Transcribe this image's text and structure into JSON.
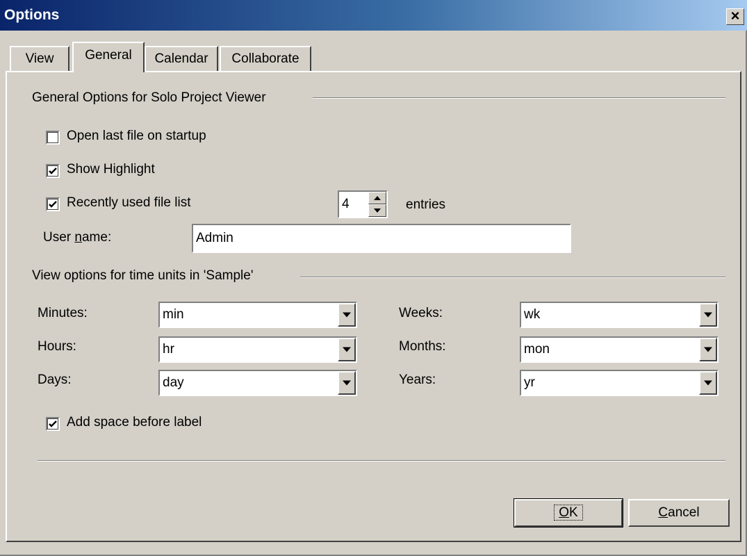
{
  "window": {
    "title": "Options",
    "close_glyph": "×"
  },
  "tabs": [
    {
      "label": "View",
      "active": false
    },
    {
      "label": "General",
      "active": true
    },
    {
      "label": "Calendar",
      "active": false
    },
    {
      "label": "Collaborate",
      "active": false
    }
  ],
  "general": {
    "section_title": "General Options for Solo Project Viewer",
    "open_last_file": {
      "label": "Open last file on startup",
      "checked": false
    },
    "show_highlight": {
      "label": "Show Highlight",
      "checked": true
    },
    "recent_files": {
      "label": "Recently used file list",
      "checked": true,
      "count": "4",
      "suffix": "entries"
    },
    "user_name": {
      "label_pre": "User ",
      "label_u": "n",
      "label_post": "ame:",
      "value": "Admin"
    }
  },
  "time_units": {
    "section_title": "View options for time units in 'Sample'",
    "minutes": {
      "label": "Minutes:",
      "value": "min"
    },
    "hours": {
      "label": "Hours:",
      "value": "hr"
    },
    "days": {
      "label": "Days:",
      "value": "day"
    },
    "weeks": {
      "label": "Weeks:",
      "value": "wk"
    },
    "months": {
      "label": "Months:",
      "value": "mon"
    },
    "years": {
      "label": "Years:",
      "value": "yr"
    },
    "add_space": {
      "label": "Add space before label",
      "checked": true
    }
  },
  "buttons": {
    "ok": {
      "u": "O",
      "rest": "K"
    },
    "cancel": {
      "u": "C",
      "rest": "ancel"
    }
  },
  "icons": {
    "checkmark": "check-icon",
    "dropdown": "triangle-down-icon",
    "close": "close-icon"
  }
}
